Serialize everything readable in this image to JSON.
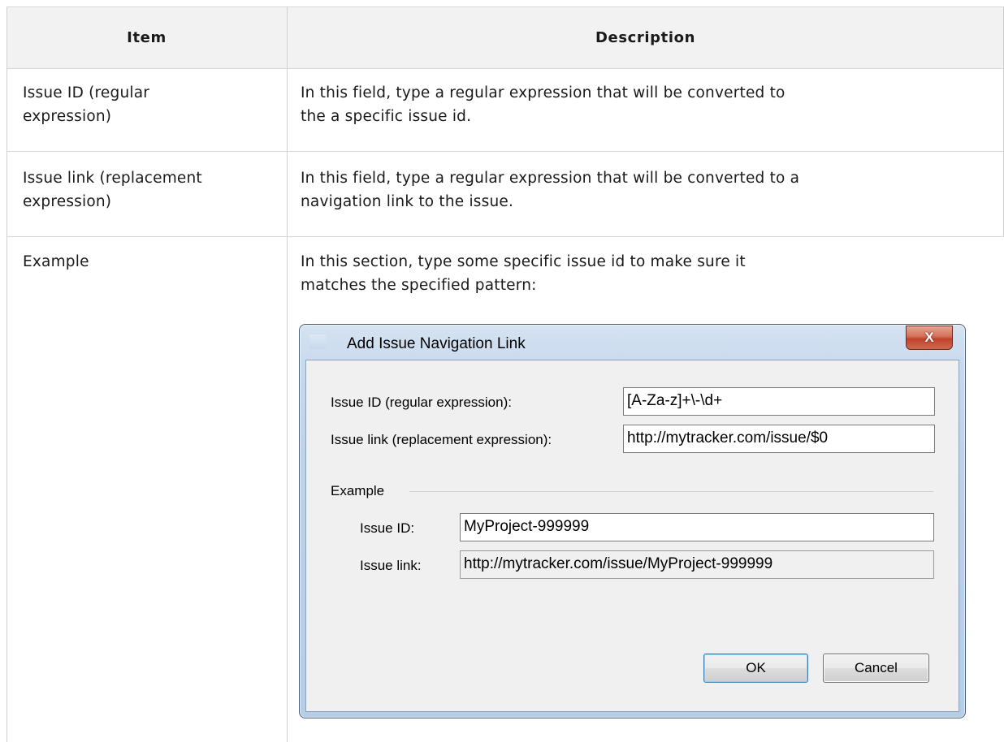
{
  "table": {
    "headers": [
      "Item",
      "Description"
    ],
    "rows": [
      {
        "item": [
          "Issue ID (regular",
          "expression)"
        ],
        "description": [
          "In this field, type a regular expression that will be converted to",
          "the a specific issue id."
        ]
      },
      {
        "item": [
          "Issue link (replacement",
          "expression)"
        ],
        "description": [
          "In this field, type a regular expression that will be converted to a",
          "navigation link to the issue."
        ]
      },
      {
        "item": [
          "Example"
        ],
        "description": [
          "In this section, type some specific issue id to make sure it",
          "matches the specified pattern:"
        ]
      }
    ]
  },
  "dialog": {
    "title": "Add Issue Navigation Link",
    "close_glyph": "X",
    "issue_id_label": "Issue ID (regular expression):",
    "issue_id_value": "[A-Za-z]+\\-\\d+",
    "issue_link_label": "Issue link (replacement expression):",
    "issue_link_value": "http://mytracker.com/issue/$0",
    "example_group_label": "Example",
    "example_id_label": "Issue ID:",
    "example_id_value": "MyProject-999999",
    "example_link_label": "Issue link:",
    "example_link_value": "http://mytracker.com/issue/MyProject-999999",
    "ok_label": "OK",
    "cancel_label": "Cancel"
  }
}
